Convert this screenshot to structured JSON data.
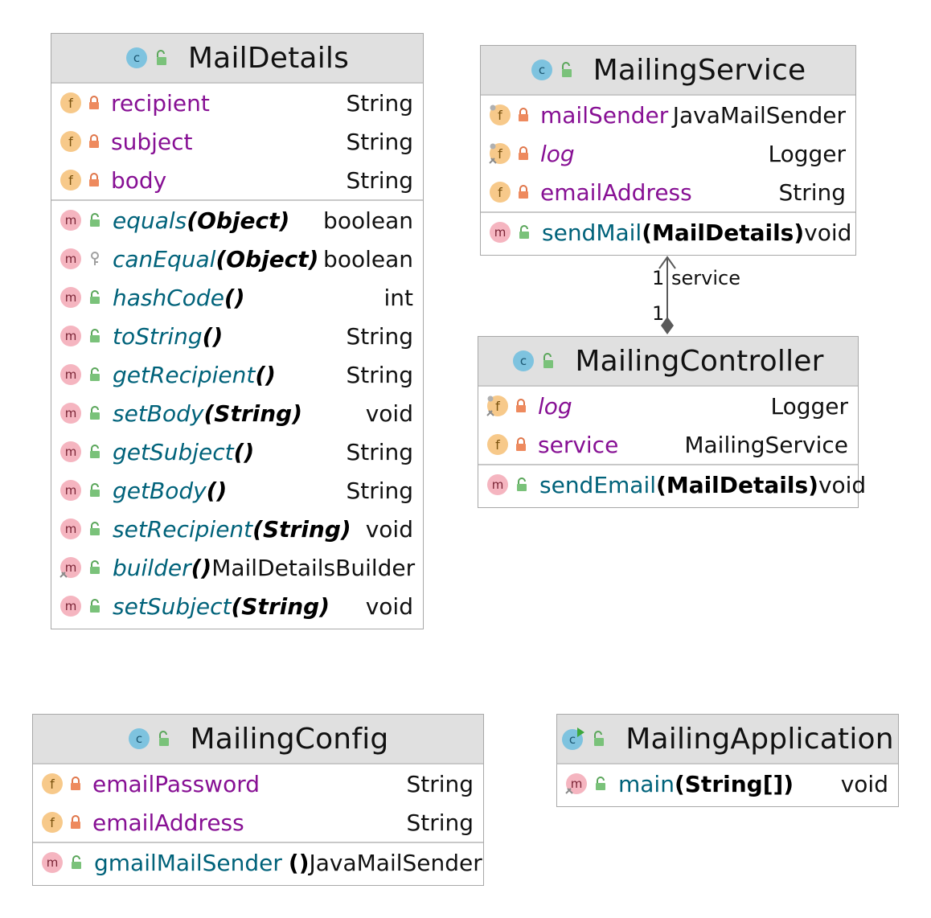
{
  "classes": {
    "mailDetails": {
      "name": "MailDetails",
      "fields": [
        {
          "name": "recipient",
          "type": "String"
        },
        {
          "name": "subject",
          "type": "String"
        },
        {
          "name": "body",
          "type": "String"
        }
      ],
      "methods": [
        {
          "name": "equals",
          "params": "(Object)",
          "type": "boolean"
        },
        {
          "name": "canEqual",
          "params": "(Object)",
          "type": "boolean"
        },
        {
          "name": "hashCode",
          "params": "()",
          "type": "int"
        },
        {
          "name": "toString",
          "params": "()",
          "type": "String"
        },
        {
          "name": "getRecipient",
          "params": "()",
          "type": "String"
        },
        {
          "name": "setBody",
          "params": "(String)",
          "type": "void"
        },
        {
          "name": "getSubject",
          "params": "()",
          "type": "String"
        },
        {
          "name": "getBody",
          "params": "()",
          "type": "String"
        },
        {
          "name": "setRecipient",
          "params": "(String)",
          "type": "void"
        },
        {
          "name": "builder",
          "params": "()",
          "type": "MailDetailsBuilder"
        },
        {
          "name": "setSubject",
          "params": "(String)",
          "type": "void"
        }
      ]
    },
    "mailingService": {
      "name": "MailingService",
      "fields": [
        {
          "name": "mailSender",
          "type": "JavaMailSender"
        },
        {
          "name": "log",
          "type": "Logger"
        },
        {
          "name": "emailAddress",
          "type": "String"
        }
      ],
      "methods": [
        {
          "name": "sendMail",
          "params": "(MailDetails)",
          "type": "void"
        }
      ]
    },
    "mailingController": {
      "name": "MailingController",
      "fields": [
        {
          "name": "log",
          "type": "Logger"
        },
        {
          "name": "service",
          "type": "MailingService"
        }
      ],
      "methods": [
        {
          "name": "sendEmail",
          "params": "(MailDetails)",
          "type": "void"
        }
      ]
    },
    "mailingConfig": {
      "name": "MailingConfig",
      "fields": [
        {
          "name": "emailPassword",
          "type": "String"
        },
        {
          "name": "emailAddress",
          "type": "String"
        }
      ],
      "methods": [
        {
          "name": "gmailMailSender",
          "params": "()",
          "type": "JavaMailSender"
        }
      ]
    },
    "mailingApplication": {
      "name": "MailingApplication",
      "methods": [
        {
          "name": "main",
          "params": "(String[])",
          "type": "void"
        }
      ]
    }
  },
  "relation": {
    "source_multiplicity": "1",
    "label": "service",
    "target_multiplicity": "1"
  },
  "colors": {
    "header_bg": "#e0e0e0",
    "field_name": "#871094",
    "method_name": "#00627a",
    "keyword_type": "#0033b3",
    "field_icon": "#f7c98a",
    "method_icon": "#f5b5c0",
    "class_icon": "#7ec3df"
  },
  "icons": {
    "class": "class-c-icon",
    "field": "field-f-icon",
    "method": "method-m-icon",
    "private": "lock-icon",
    "public": "unlock-icon",
    "protected": "key-icon"
  }
}
